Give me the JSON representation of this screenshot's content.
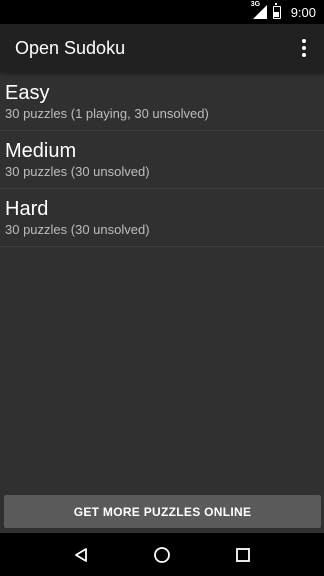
{
  "status_bar": {
    "network_label": "3G",
    "time": "9:00"
  },
  "app_bar": {
    "title": "Open Sudoku",
    "overflow_icon": "more-vert-icon"
  },
  "folders": [
    {
      "name": "Easy",
      "detail": "30 puzzles (1 playing, 30 unsolved)"
    },
    {
      "name": "Medium",
      "detail": "30 puzzles (30 unsolved)"
    },
    {
      "name": "Hard",
      "detail": "30 puzzles (30 unsolved)"
    }
  ],
  "bottom_button": {
    "label": "GET MORE PUZZLES ONLINE"
  },
  "nav_bar": {
    "icons": [
      "back-icon",
      "home-icon",
      "recents-icon"
    ]
  }
}
